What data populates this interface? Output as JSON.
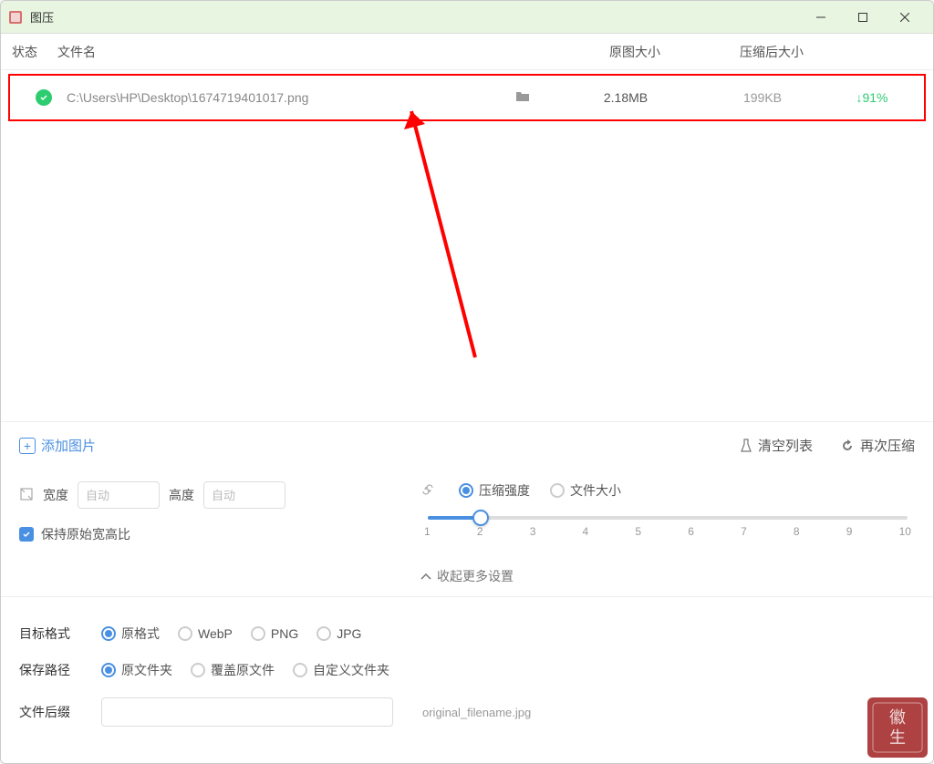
{
  "app": {
    "title": "图压"
  },
  "columns": {
    "status": "状态",
    "filename": "文件名",
    "origsize": "原图大小",
    "compressed": "压缩后大小"
  },
  "file": {
    "path": "C:\\Users\\HP\\Desktop\\1674719401017.png",
    "original_size": "2.18MB",
    "compressed_size": "199KB",
    "ratio": "91%"
  },
  "actions": {
    "add": "添加图片",
    "clear": "清空列表",
    "recompress": "再次压缩"
  },
  "dimensions": {
    "width_label": "宽度",
    "height_label": "高度",
    "placeholder": "自动",
    "keep_aspect": "保持原始宽高比"
  },
  "compression": {
    "mode_strength": "压缩强度",
    "mode_filesize": "文件大小"
  },
  "slider_ticks": [
    "1",
    "2",
    "3",
    "4",
    "5",
    "6",
    "7",
    "8",
    "9",
    "10"
  ],
  "collapse": "收起更多设置",
  "format": {
    "label": "目标格式",
    "options": [
      "原格式",
      "WebP",
      "PNG",
      "JPG"
    ]
  },
  "save_path": {
    "label": "保存路径",
    "options": [
      "原文件夹",
      "覆盖原文件",
      "自定义文件夹"
    ]
  },
  "suffix": {
    "label": "文件后缀",
    "example": "original_filename.jpg"
  }
}
